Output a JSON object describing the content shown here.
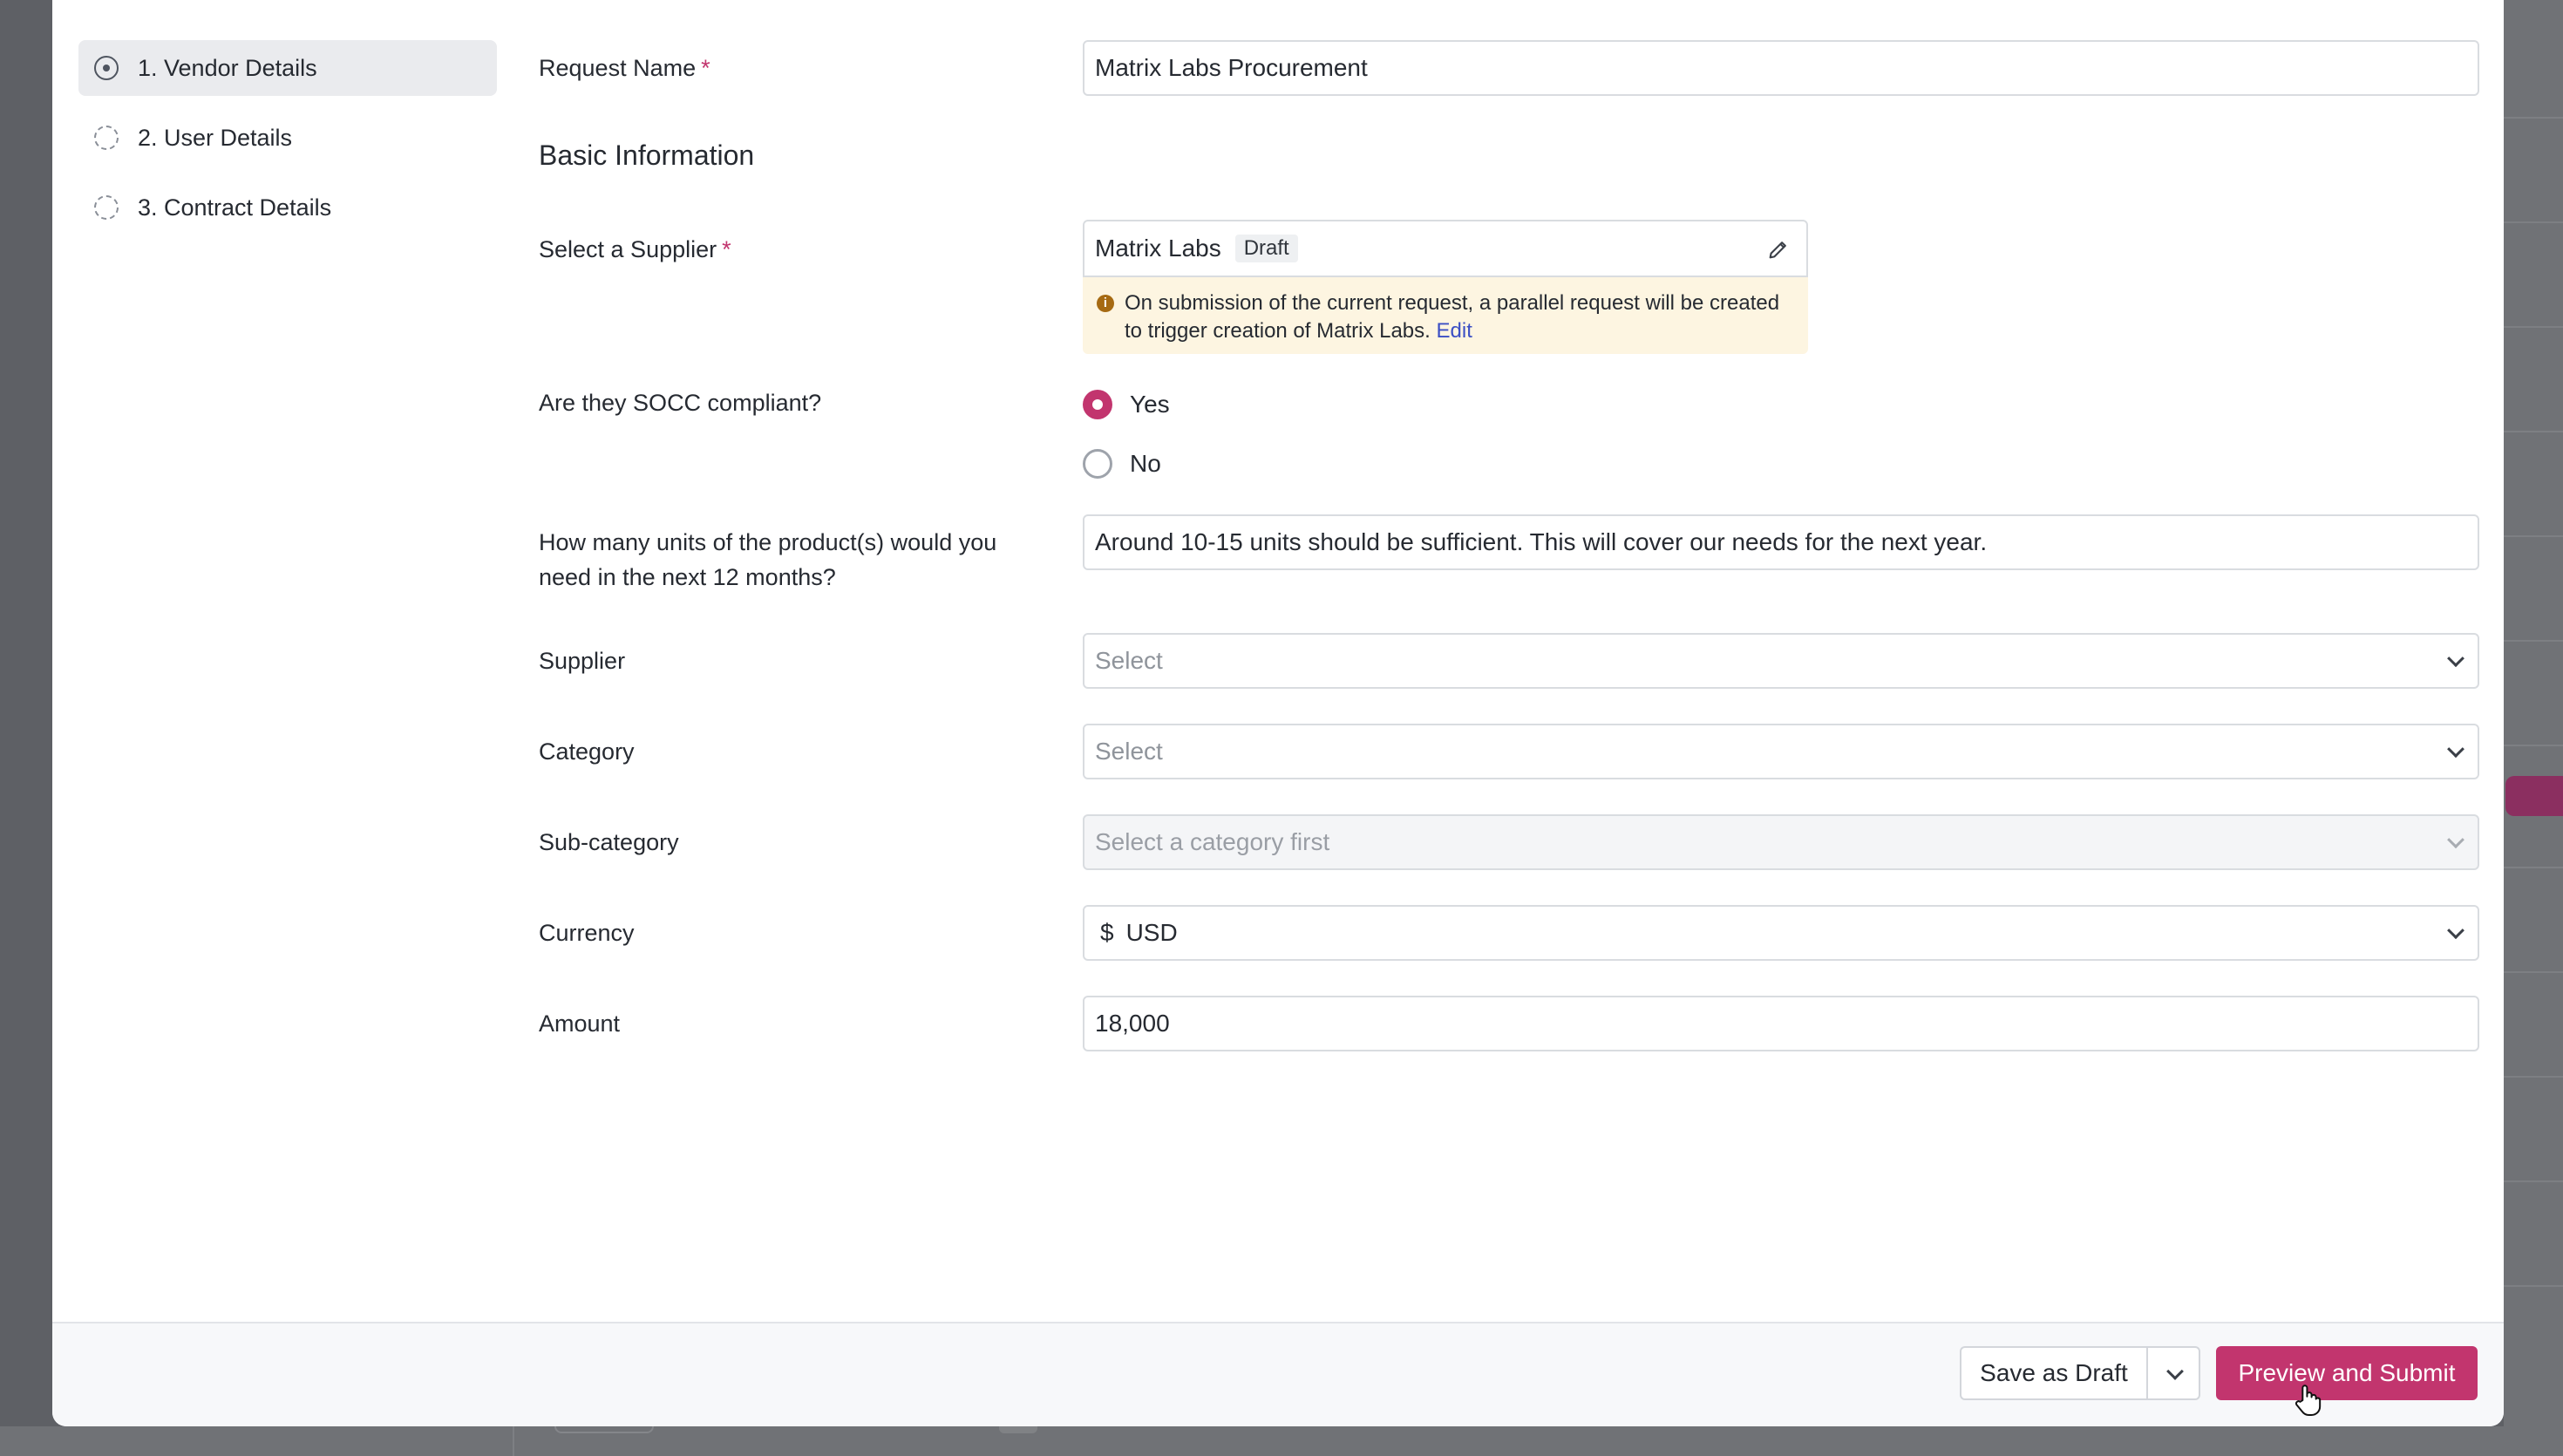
{
  "steps": [
    {
      "label": "1. Vendor Details",
      "state": "active"
    },
    {
      "label": "2. User Details",
      "state": "pending"
    },
    {
      "label": "3. Contract Details",
      "state": "pending"
    }
  ],
  "form": {
    "request_name": {
      "label": "Request Name",
      "required": "*",
      "value": "Matrix Labs Procurement"
    },
    "section_title": "Basic Information",
    "select_supplier": {
      "label": "Select a Supplier",
      "required": "*",
      "value": "Matrix Labs",
      "badge": "Draft",
      "notice_text": "On submission of the current request, a parallel request will be created to trigger creation of Matrix Labs.",
      "notice_link": "Edit"
    },
    "socc": {
      "label": "Are they SOCC compliant?",
      "options": [
        {
          "label": "Yes",
          "selected": true
        },
        {
          "label": "No",
          "selected": false
        }
      ]
    },
    "units": {
      "label": "How many units of the product(s) would you need in the next 12 months?",
      "value": "Around 10-15 units should be sufficient. This will cover our needs for the next year."
    },
    "supplier": {
      "label": "Supplier",
      "placeholder": "Select"
    },
    "category": {
      "label": "Category",
      "placeholder": "Select"
    },
    "subcategory": {
      "label": "Sub-category",
      "placeholder": "Select a category first"
    },
    "currency": {
      "label": "Currency",
      "symbol": "$",
      "value": "USD"
    },
    "amount": {
      "label": "Amount",
      "value": "18,000"
    }
  },
  "footer": {
    "save_draft": "Save as Draft",
    "submit": "Preview and Submit"
  },
  "colors": {
    "accent": "#c2356e",
    "notice_bg": "#fdf5e1",
    "link": "#3b4fc4"
  }
}
